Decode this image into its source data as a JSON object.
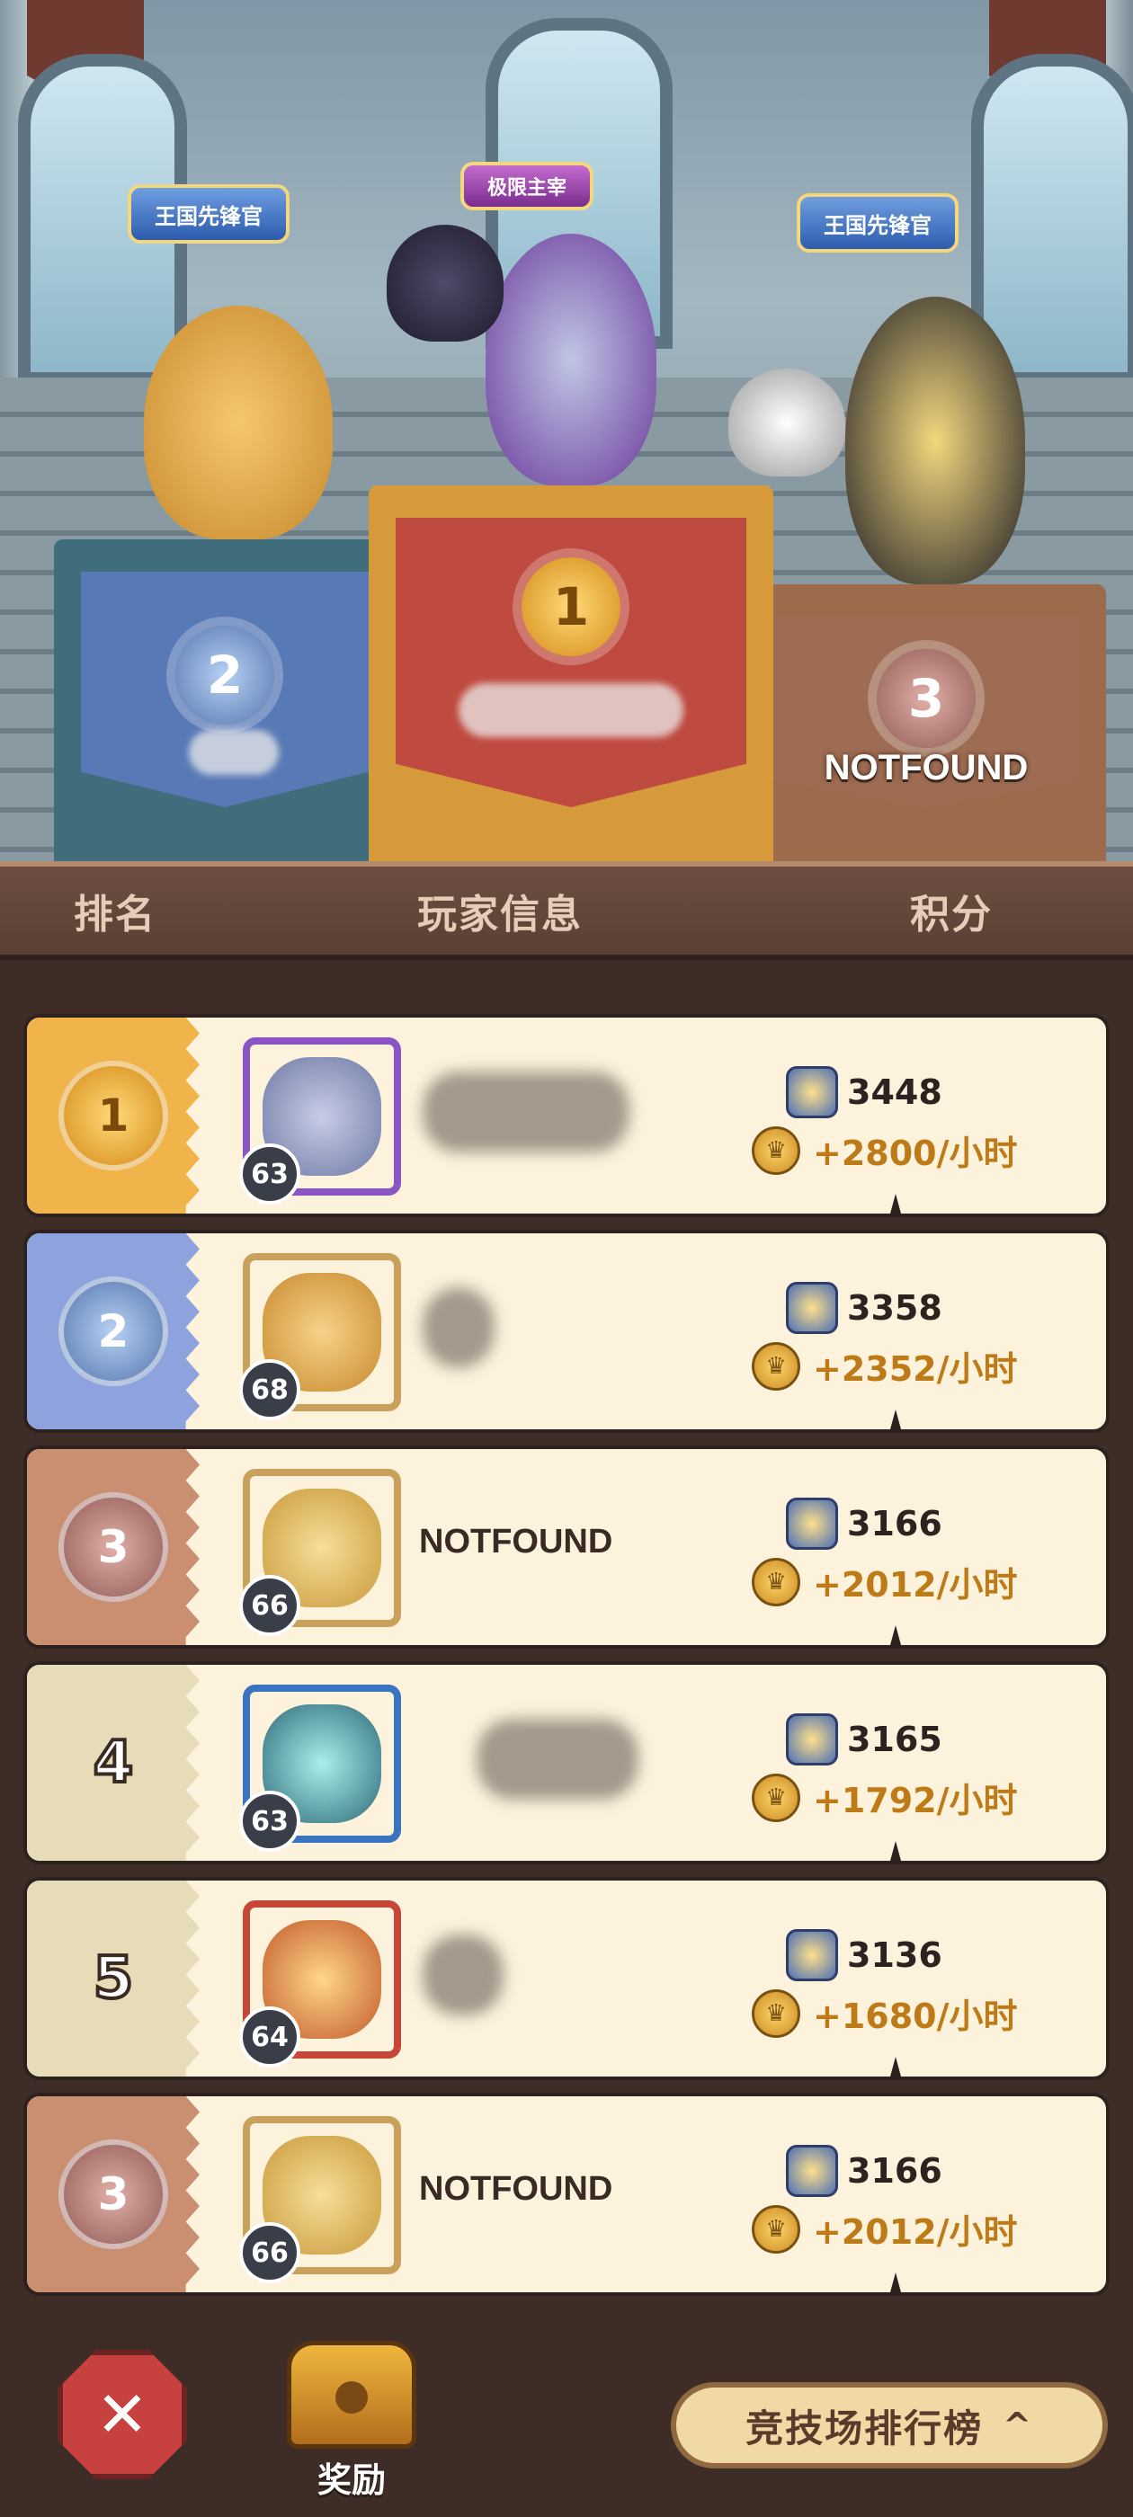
{
  "podium": {
    "first": {
      "title": "极限主宰",
      "name": ""
    },
    "second": {
      "title": "王国先锋官",
      "name": ""
    },
    "third": {
      "title": "王国先锋官",
      "name": "NOTFOUND"
    },
    "medal_first": "1",
    "medal_second": "2",
    "medal_third": "3"
  },
  "header": {
    "rank": "排名",
    "player_info": "玩家信息",
    "score": "积分"
  },
  "rows": [
    {
      "rank": "1",
      "level": "63",
      "name": "",
      "score": "3448",
      "rate": "+2800/小时"
    },
    {
      "rank": "2",
      "level": "68",
      "name": "",
      "score": "3358",
      "rate": "+2352/小时"
    },
    {
      "rank": "3",
      "level": "66",
      "name": "NOTFOUND",
      "score": "3166",
      "rate": "+2012/小时"
    },
    {
      "rank": "4",
      "level": "63",
      "name": "",
      "score": "3165",
      "rate": "+1792/小时"
    },
    {
      "rank": "5",
      "level": "64",
      "name": "",
      "score": "3136",
      "rate": "+1680/小时"
    },
    {
      "rank": "3",
      "level": "66",
      "name": "NOTFOUND",
      "score": "3166",
      "rate": "+2012/小时"
    }
  ],
  "bottom": {
    "battle_icon": "✕",
    "reward_label": "奖励",
    "arena_label": "竞技场排行榜",
    "chevron": "^"
  },
  "icons": {
    "score": "trophy-icon",
    "rate": "coin-icon"
  }
}
